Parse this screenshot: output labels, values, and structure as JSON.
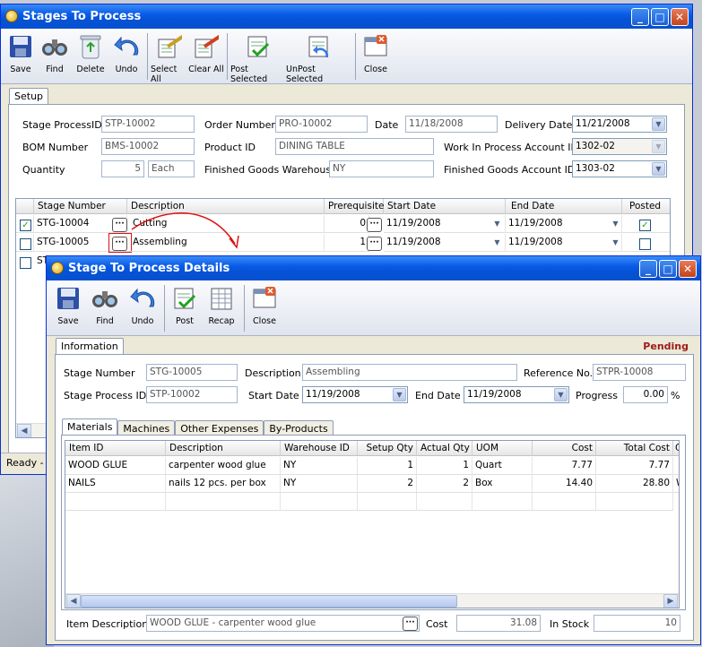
{
  "main_window": {
    "title": "Stages To Process",
    "toolbar": [
      "Save",
      "Find",
      "Delete",
      "Undo",
      "Select All",
      "Clear All",
      "Post Selected",
      "UnPost Selected",
      "Close"
    ],
    "tab": "Setup",
    "labels": {
      "stage_process_id": "Stage ProcessID",
      "order_number": "Order Number",
      "date": "Date",
      "delivery_date": "Delivery Date",
      "bom_number": "BOM Number",
      "product_id": "Product ID",
      "wip_account": "Work In Process Account ID",
      "quantity": "Quantity",
      "fg_warehouse": "Finished Goods Warehouse",
      "fg_account": "Finished Goods Account ID"
    },
    "values": {
      "stage_process_id": "STP-10002",
      "order_number": "PRO-10002",
      "date": "11/18/2008",
      "delivery_date": "11/21/2008",
      "bom_number": "BMS-10002",
      "product_id": "DINING TABLE",
      "wip_account": "1302-02",
      "quantity": "5",
      "unit": "Each",
      "fg_warehouse": "NY",
      "fg_account": "1303-02"
    },
    "grid": {
      "columns": [
        "Stage Number",
        "Description",
        "Prerequisites",
        "Start Date",
        "End Date",
        "Posted"
      ],
      "rows": [
        {
          "stage": "STG-10004",
          "desc": "Cutting",
          "prereq": "0",
          "start": "11/19/2008",
          "end": "11/19/2008",
          "checked": "✓",
          "posted": "✓"
        },
        {
          "stage": "STG-10005",
          "desc": "Assembling",
          "prereq": "1",
          "start": "11/19/2008",
          "end": "11/19/2008",
          "checked": "",
          "posted": ""
        },
        {
          "stage": "ST",
          "desc": "",
          "prereq": "",
          "start": "",
          "end": "",
          "checked": "",
          "posted": ""
        }
      ]
    },
    "status": "Ready - I"
  },
  "detail_window": {
    "title": "Stage To Process Details",
    "toolbar": [
      "Save",
      "Find",
      "Undo",
      "Post",
      "Recap",
      "Close"
    ],
    "tab": "Information",
    "status": "Pending",
    "labels": {
      "stage_number": "Stage Number",
      "description": "Description",
      "reference_no": "Reference No.",
      "stage_process_id": "Stage Process ID",
      "start_date": "Start Date",
      "end_date": "End Date",
      "progress": "Progress",
      "percent": "%"
    },
    "values": {
      "stage_number": "STG-10005",
      "description": "Assembling",
      "reference_no": "STPR-10008",
      "stage_process_id": "STP-10002",
      "start_date": "11/19/2008",
      "end_date": "11/19/2008",
      "progress": "0.00"
    },
    "subtabs": [
      "Materials",
      "Machines",
      "Other Expenses",
      "By-Products"
    ],
    "grid": {
      "columns": [
        "Item ID",
        "Description",
        "Warehouse ID",
        "Setup Qty",
        "Actual Qty",
        "UOM",
        "Cost",
        "Total Cost",
        "C"
      ],
      "rows": [
        {
          "item": "WOOD GLUE",
          "desc": "carpenter wood glue",
          "wh": "NY",
          "setup": "1",
          "actual": "1",
          "uom": "Quart",
          "cost": "7.77",
          "total": "7.77",
          "c": ""
        },
        {
          "item": "NAILS",
          "desc": "nails 12 pcs. per box",
          "wh": "NY",
          "setup": "2",
          "actual": "2",
          "uom": "Box",
          "cost": "14.40",
          "total": "28.80",
          "c": "W"
        }
      ]
    },
    "footer": {
      "item_description_label": "Item Description",
      "item_description": "WOOD GLUE - carpenter wood glue",
      "cost_label": "Cost",
      "cost": "31.08",
      "in_stock_label": "In Stock",
      "in_stock": "10"
    }
  },
  "icons": [
    "floppy-icon",
    "binoculars-icon",
    "recycle-bin-icon",
    "undo-arrow-icon",
    "select-all-icon",
    "clear-all-icon",
    "post-icon",
    "unpost-icon",
    "close-window-icon",
    "recap-icon"
  ]
}
